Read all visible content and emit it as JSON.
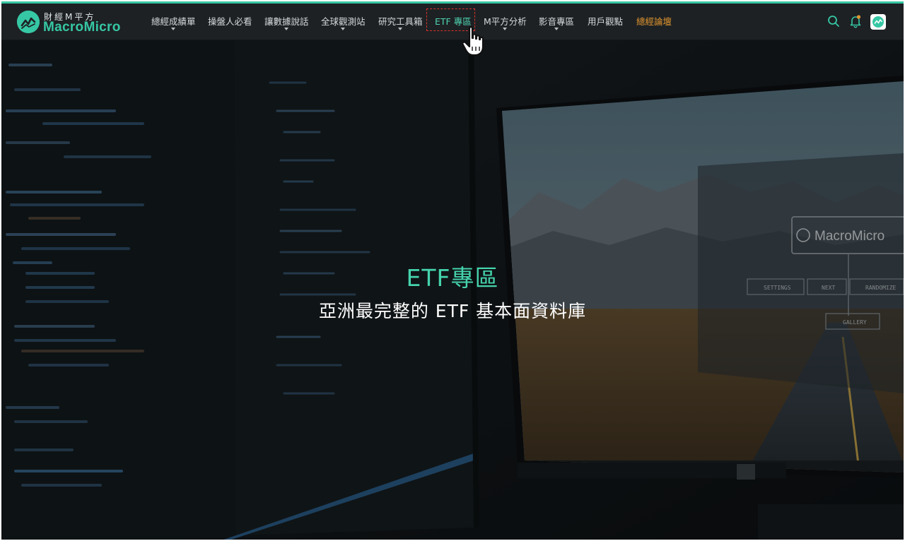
{
  "brand": {
    "name_cn": "財經M平方",
    "name_en": "MacroMicro"
  },
  "nav": {
    "items": [
      {
        "label": "總經成績單",
        "has_dropdown": true
      },
      {
        "label": "操盤人必看",
        "has_dropdown": false
      },
      {
        "label": "讓數據說話",
        "has_dropdown": true
      },
      {
        "label": "全球觀測站",
        "has_dropdown": true
      },
      {
        "label": "研究工具箱",
        "has_dropdown": true
      },
      {
        "label": "ETF 專區",
        "has_dropdown": false,
        "active": true
      },
      {
        "label": "M平方分析",
        "has_dropdown": true
      },
      {
        "label": "影音專區",
        "has_dropdown": true
      },
      {
        "label": "用戶觀點",
        "has_dropdown": false
      },
      {
        "label": "總經論壇",
        "has_dropdown": false,
        "special": true
      }
    ]
  },
  "toolbar": {
    "icons": [
      "search-icon",
      "bell-icon",
      "user-avatar"
    ]
  },
  "hero": {
    "title": "ETF專區",
    "subtitle": "亞洲最完整的 ETF 基本面資料庫",
    "monitor_logo": "MacroMicro",
    "monitor_buttons": [
      "SETTINGS",
      "NEXT",
      "RANDOMIZE"
    ],
    "monitor_gallery": "GALLERY"
  },
  "colors": {
    "accent": "#36c7a4",
    "nav_bg": "#1d2124",
    "special": "#e3962f",
    "highlight": "#d9332b"
  }
}
